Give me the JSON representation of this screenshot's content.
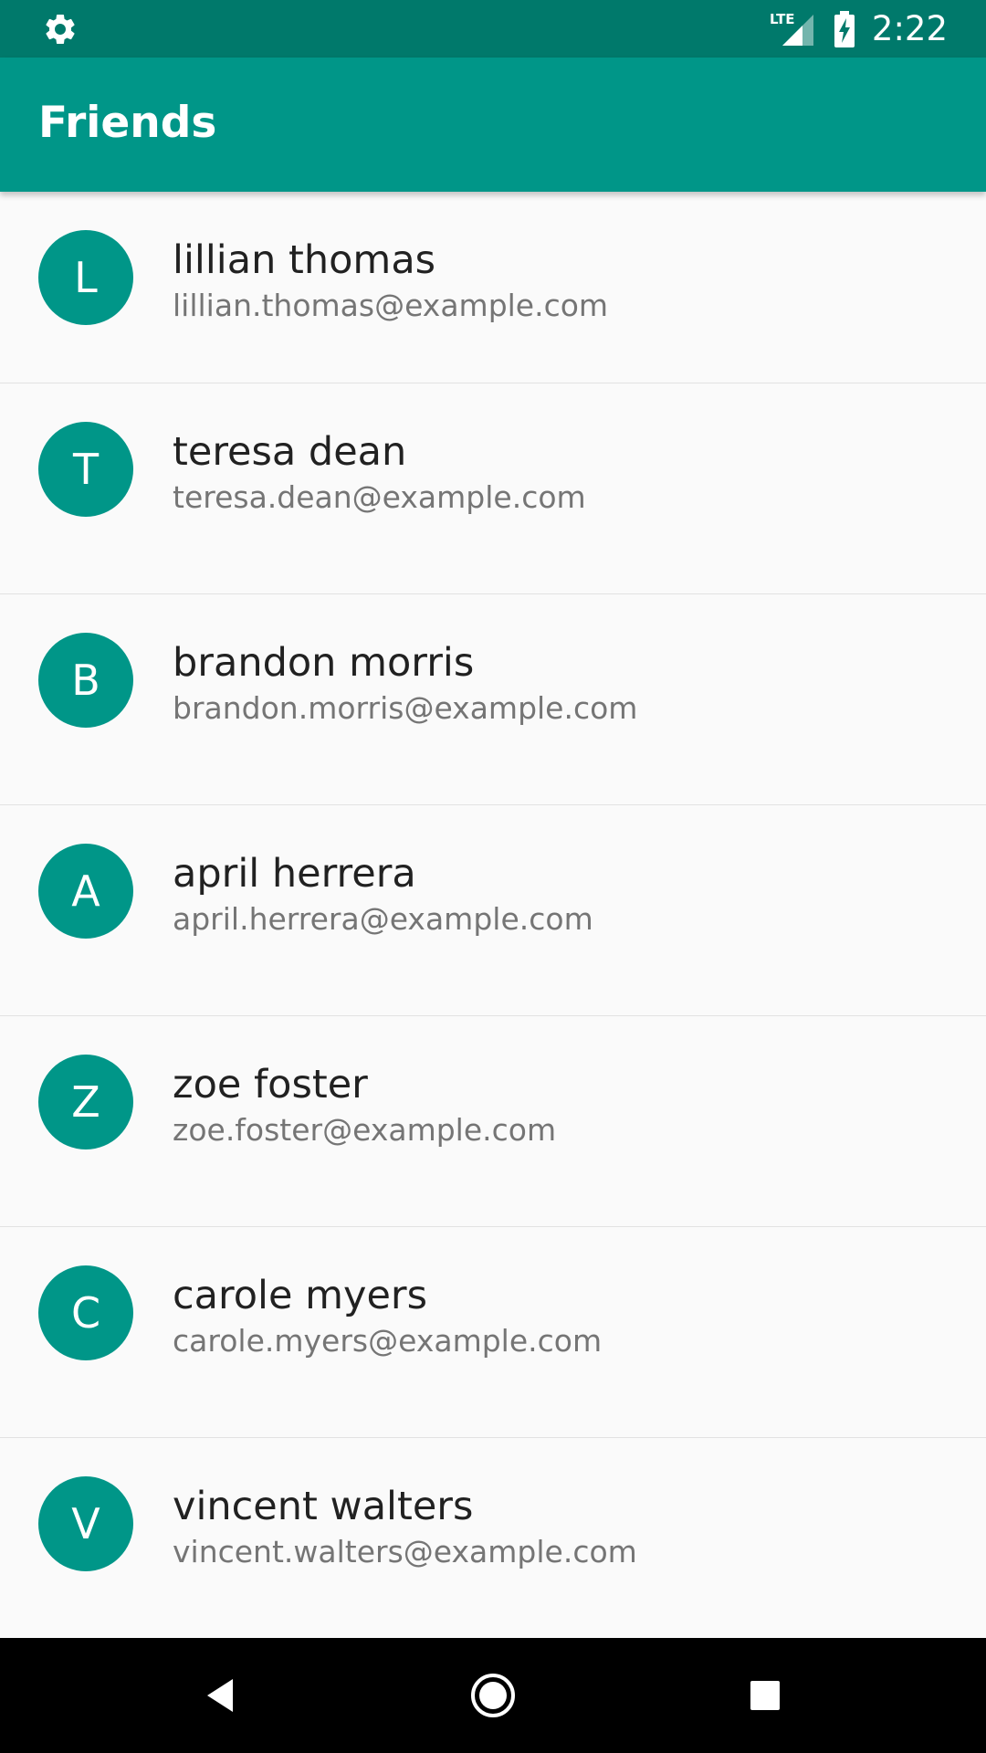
{
  "status_bar": {
    "time": "2:22",
    "network": "LTE",
    "icons": [
      "gear-icon",
      "lte-signal-icon",
      "battery-charging-icon"
    ]
  },
  "app_bar": {
    "title": "Friends"
  },
  "friends": [
    {
      "initial": "L",
      "name": "lillian thomas",
      "email": "lillian.thomas@example.com"
    },
    {
      "initial": "T",
      "name": "teresa dean",
      "email": "teresa.dean@example.com"
    },
    {
      "initial": "B",
      "name": "brandon morris",
      "email": "brandon.morris@example.com"
    },
    {
      "initial": "A",
      "name": "april herrera",
      "email": "april.herrera@example.com"
    },
    {
      "initial": "Z",
      "name": "zoe foster",
      "email": "zoe.foster@example.com"
    },
    {
      "initial": "C",
      "name": "carole myers",
      "email": "carole.myers@example.com"
    },
    {
      "initial": "V",
      "name": "vincent walters",
      "email": "vincent.walters@example.com"
    }
  ],
  "nav_bar": {
    "icons": [
      "back-icon",
      "home-icon",
      "recents-icon"
    ]
  },
  "colors": {
    "primary": "#009688",
    "primary_dark": "#00796b",
    "background": "#fafafa",
    "name_text": "#212121",
    "email_text": "#757575"
  }
}
